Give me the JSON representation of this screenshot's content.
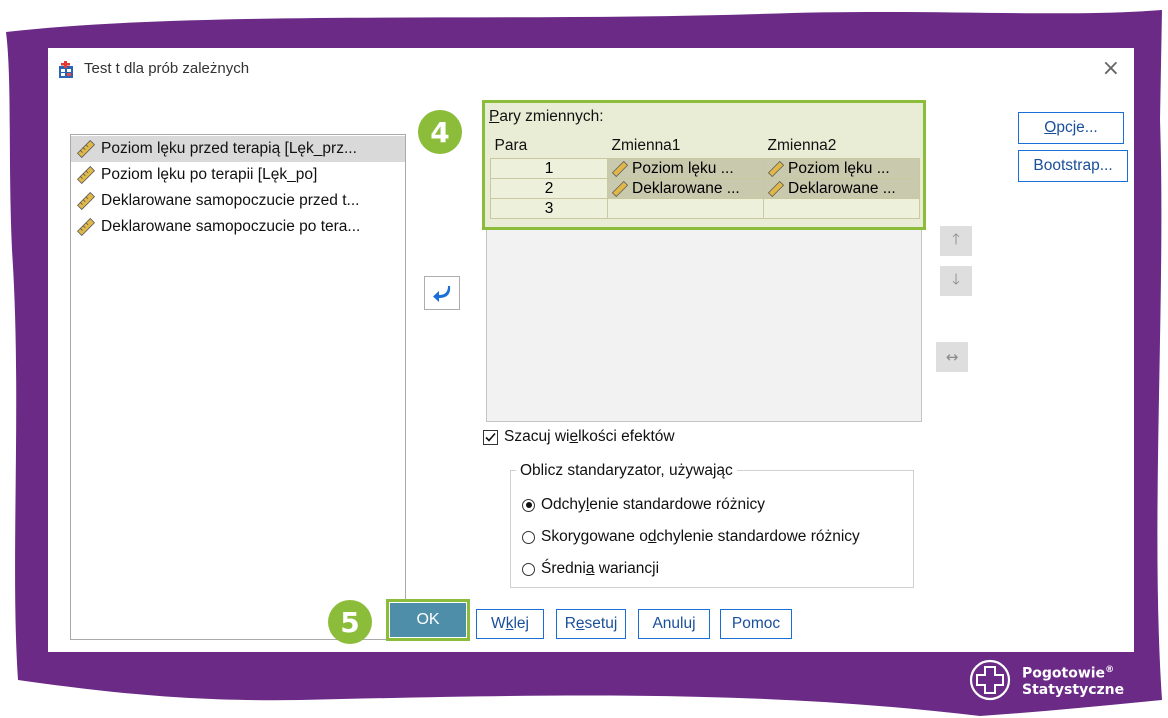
{
  "dialog": {
    "title": "Test t dla prób zależnych",
    "close_symbol": "×"
  },
  "source_variables": [
    {
      "label": "Poziom lęku przed terapią [Lęk_prz...",
      "selected": true
    },
    {
      "label": "Poziom lęku po terapii [Lęk_po]",
      "selected": false
    },
    {
      "label": "Deklarowane samopoczucie przed t...",
      "selected": false
    },
    {
      "label": "Deklarowane samopoczucie po tera...",
      "selected": false
    }
  ],
  "pairs": {
    "label_accesskey": "P",
    "label_rest": "ary zmiennych:",
    "headers": [
      "Para",
      "Zmienna1",
      "Zmienna2"
    ],
    "rows": [
      {
        "num": "1",
        "var1": "Poziom lęku ...",
        "var2": "Poziom lęku ..."
      },
      {
        "num": "2",
        "var1": "Deklarowane ...",
        "var2": "Deklarowane ..."
      },
      {
        "num": "3",
        "var1": "",
        "var2": ""
      }
    ]
  },
  "side_buttons": {
    "up": "🡑",
    "down": "🡓",
    "swap": "↔"
  },
  "top_buttons": {
    "options_accesskey": "O",
    "options_rest": "pcje...",
    "bootstrap": "Bootstrap..."
  },
  "effect_size": {
    "checked": true,
    "label_a": "Szacuj wi",
    "label_accesskey": "e",
    "label_b": "lkości efektów"
  },
  "standardizer": {
    "legend": "Oblicz standaryzator, używając",
    "options": [
      {
        "a": "Odchy",
        "k": "l",
        "b": "enie standardowe różnicy",
        "selected": true
      },
      {
        "a": "Skorygowane o",
        "k": "d",
        "b": "chylenie standardowe różnicy",
        "selected": false
      },
      {
        "a": "Średni",
        "k": "a",
        "b": " wariancji",
        "selected": false
      }
    ]
  },
  "bottom_buttons": {
    "ok": "OK",
    "paste_a": "W",
    "paste_k": "k",
    "paste_b": "lej",
    "reset_a": "R",
    "reset_k": "e",
    "reset_b": "setuj",
    "cancel": "Anuluj",
    "help": "Pomoc"
  },
  "steps": {
    "four": "4",
    "five": "5"
  },
  "brand": {
    "line1": "Pogotowie",
    "reg": "®",
    "line2": "Statystyczne"
  },
  "colors": {
    "frame_purple": "#6b2a86",
    "accent_green": "#8cbd3a",
    "ok_button": "#4e8ea8",
    "button_border": "#1a6ed8"
  }
}
